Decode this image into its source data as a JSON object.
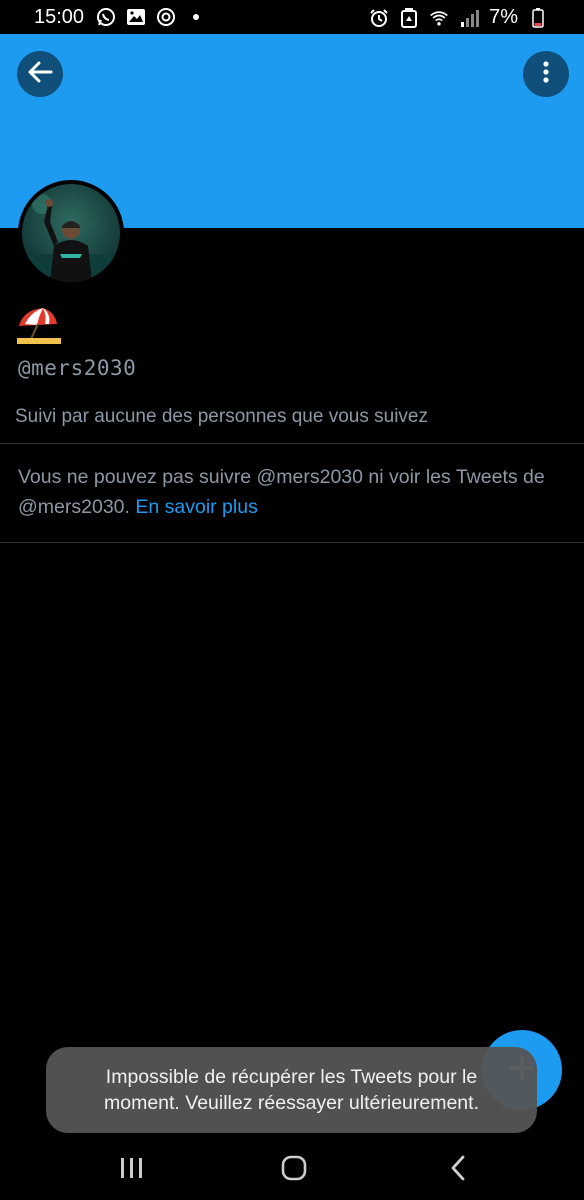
{
  "status_bar": {
    "time": "15:00",
    "battery": "7%",
    "left_icons": [
      "whatsapp-icon",
      "gallery-icon",
      "sync-icon",
      "dot-icon"
    ],
    "right_icons": [
      "alarm-icon",
      "recycle-icon",
      "wifi-icon",
      "signal-icon",
      "battery-icon"
    ]
  },
  "header": {
    "banner_color": "#1d9bf0",
    "back_icon": "arrow-left-icon",
    "more_icon": "more-vertical-icon"
  },
  "profile": {
    "display_name_emoji": "beach-umbrella-emoji",
    "handle": "@mers2030",
    "followed_by": "Suivi par aucune des personnes que vous suivez",
    "protected_text": "Vous ne pouvez pas suivre @mers2030 ni voir les Tweets de @mers2030.",
    "learn_more": "En savoir plus"
  },
  "fab": {
    "icon": "plus-icon",
    "color": "#1d9bf0"
  },
  "toast": {
    "line1": "Impossible de récupérer les Tweets pour le",
    "line2": "moment. Veuillez réessayer ultérieurement."
  },
  "nav_bar": {
    "recents_icon": "recents-icon",
    "home_icon": "home-icon",
    "back_icon": "chevron-left-icon"
  },
  "colors": {
    "accent": "#1d9bf0",
    "secondary_text": "#8b98a5",
    "divider": "#2f3336"
  }
}
